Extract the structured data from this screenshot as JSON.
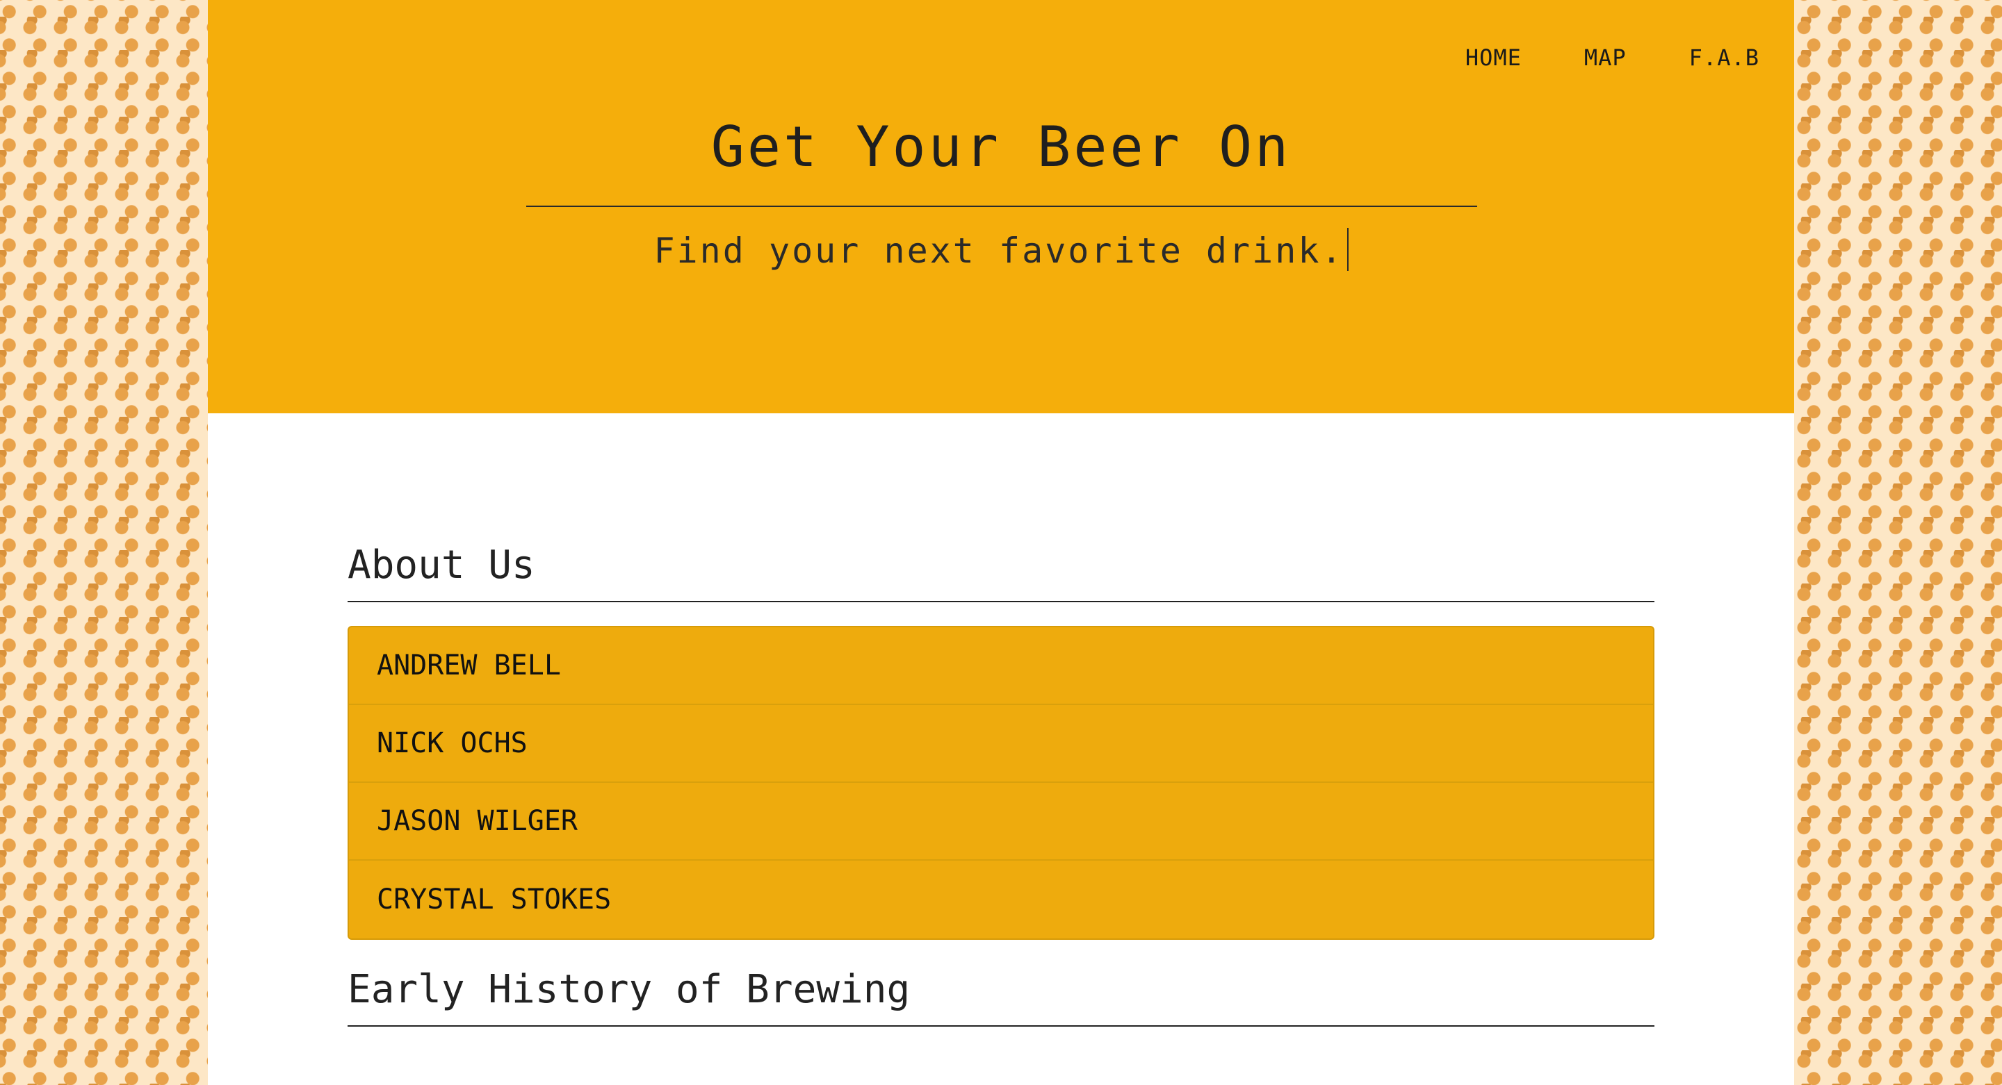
{
  "nav": {
    "items": [
      {
        "label": "HOME"
      },
      {
        "label": "MAP"
      },
      {
        "label": "F.A.B"
      }
    ]
  },
  "hero": {
    "title": "Get Your Beer On",
    "subtitle": "Find your next favorite drink."
  },
  "about": {
    "title": "About Us",
    "members": [
      {
        "name": "ANDREW BELL"
      },
      {
        "name": "NICK OCHS"
      },
      {
        "name": "JASON WILGER"
      },
      {
        "name": "CRYSTAL STOKES"
      }
    ]
  },
  "history": {
    "title": "Early History of Brewing"
  },
  "colors": {
    "hero_background": "#f5ae0b",
    "list_background": "#eeab0d",
    "page_background": "#fde7c6",
    "pattern_icon": "beer-mug-icon"
  }
}
